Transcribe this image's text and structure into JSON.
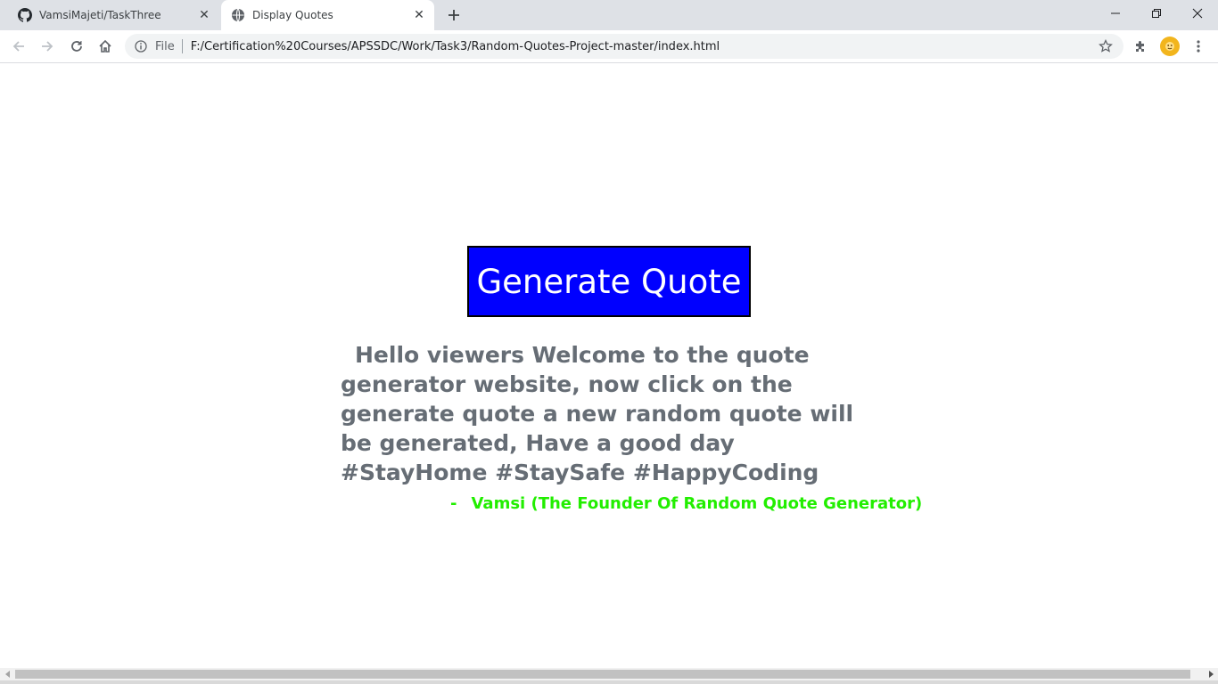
{
  "tabs": [
    {
      "title": "VamsiMajeti/TaskThree",
      "icon": "github-icon"
    },
    {
      "title": "Display Quotes",
      "icon": "globe-icon"
    }
  ],
  "omnibox": {
    "scheme_label": "File",
    "url": "F:/Certification%20Courses/APSSDC/Work/Task3/Random-Quotes-Project-master/index.html"
  },
  "page": {
    "button_label": "Generate Quote",
    "quote_text": "Hello viewers Welcome to the quote generator website, now click on the generate quote a new random quote will be generated, Have a good day #StayHome #StaySafe #HappyCoding",
    "author_dash": "-",
    "author_text": "Vamsi (The Founder Of Random Quote Generator)"
  },
  "colors": {
    "button_bg": "#0000ff",
    "quote_text": "#666d75",
    "author_text": "#22ee00"
  }
}
